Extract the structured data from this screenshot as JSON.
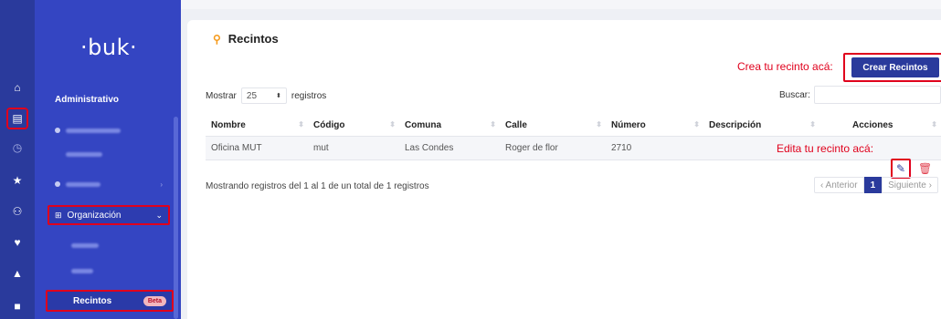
{
  "sidebar": {
    "logo": "·buk·",
    "section_title": "Administrativo",
    "organizacion_label": "Organización",
    "recintos_label": "Recintos",
    "recintos_badge": "Beta"
  },
  "rail_icons": [
    "home-icon",
    "clipboard-icon",
    "clock-icon",
    "star-icon",
    "people-icon",
    "hand-heart-icon",
    "graduation-cap-icon",
    "folder-icon"
  ],
  "page": {
    "title": "Recintos",
    "create_annotation": "Crea tu recinto acá:",
    "create_button": "Crear Recintos",
    "edit_annotation": "Edita tu recinto acá:",
    "show_prefix": "Mostrar",
    "show_value": "25",
    "show_suffix": "registros",
    "search_label": "Buscar:",
    "info": "Mostrando registros del 1 al 1 de un total de 1 registros",
    "pager": {
      "prev": "‹ Anterior",
      "page": "1",
      "next": "Siguiente ›"
    }
  },
  "table": {
    "headers": [
      "Nombre",
      "Código",
      "Comuna",
      "Calle",
      "Número",
      "Descripción",
      "Acciones"
    ],
    "rows": [
      [
        "Oficina MUT",
        "mut",
        "Las Condes",
        "Roger de flor",
        "2710",
        ""
      ]
    ]
  },
  "colors": {
    "brand": "#3445c2",
    "rail": "#2a3a9c",
    "annotation": "#e0001c"
  }
}
